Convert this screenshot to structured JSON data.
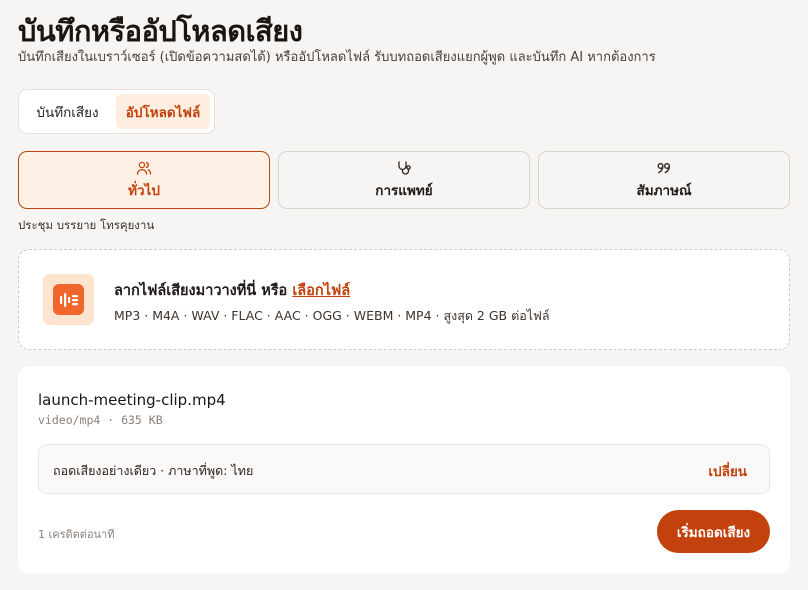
{
  "page": {
    "title": "บันทึกหรืออัปโหลดเสียง",
    "subtitle": "บันทึกเสียงในเบราว์เซอร์ (เปิดข้อความสดได้) หรืออัปโหลดไฟล์ รับบทถอดเสียงแยกผู้พูด และบันทึก AI หากต้องการ"
  },
  "mode_switch": {
    "record_label": "บันทึกเสียง",
    "upload_label": "อัปโหลดไฟล์",
    "selected": "upload"
  },
  "categories": [
    {
      "label": "ทั่วไป",
      "icon": "users-icon",
      "active": true
    },
    {
      "label": "การแพทย์",
      "icon": "stethoscope-icon",
      "active": false
    },
    {
      "label": "สัมภาษณ์",
      "icon": "quote-icon",
      "active": false
    }
  ],
  "category_description": "ประชุม บรรยาย โทรคุยงาน",
  "dropzone": {
    "icon": "audio-file-icon",
    "prompt": "ลากไฟล์เสียงมาวางที่นี่ หรือ ",
    "link_label": "เลือกไฟล์",
    "formats": "MP3 · M4A · WAV · FLAC · AAC · OGG · WEBM · MP4 · สูงสุด 2 GB ต่อไฟล์"
  },
  "file": {
    "name": "launch-meeting-clip.mp4",
    "meta": "video/mp4 · 635 KB",
    "options_text": "ถอดเสียงอย่างเดียว · ภาษาที่พูด: ไทย",
    "change_label": "เปลี่ยน",
    "credits": "1 เครดิตต่อนาที",
    "start_label": "เริ่มถอดเสียง"
  },
  "colors": {
    "accent": "#c2410c",
    "accent_light": "#fdf0e4",
    "background": "#f6f5f3"
  }
}
